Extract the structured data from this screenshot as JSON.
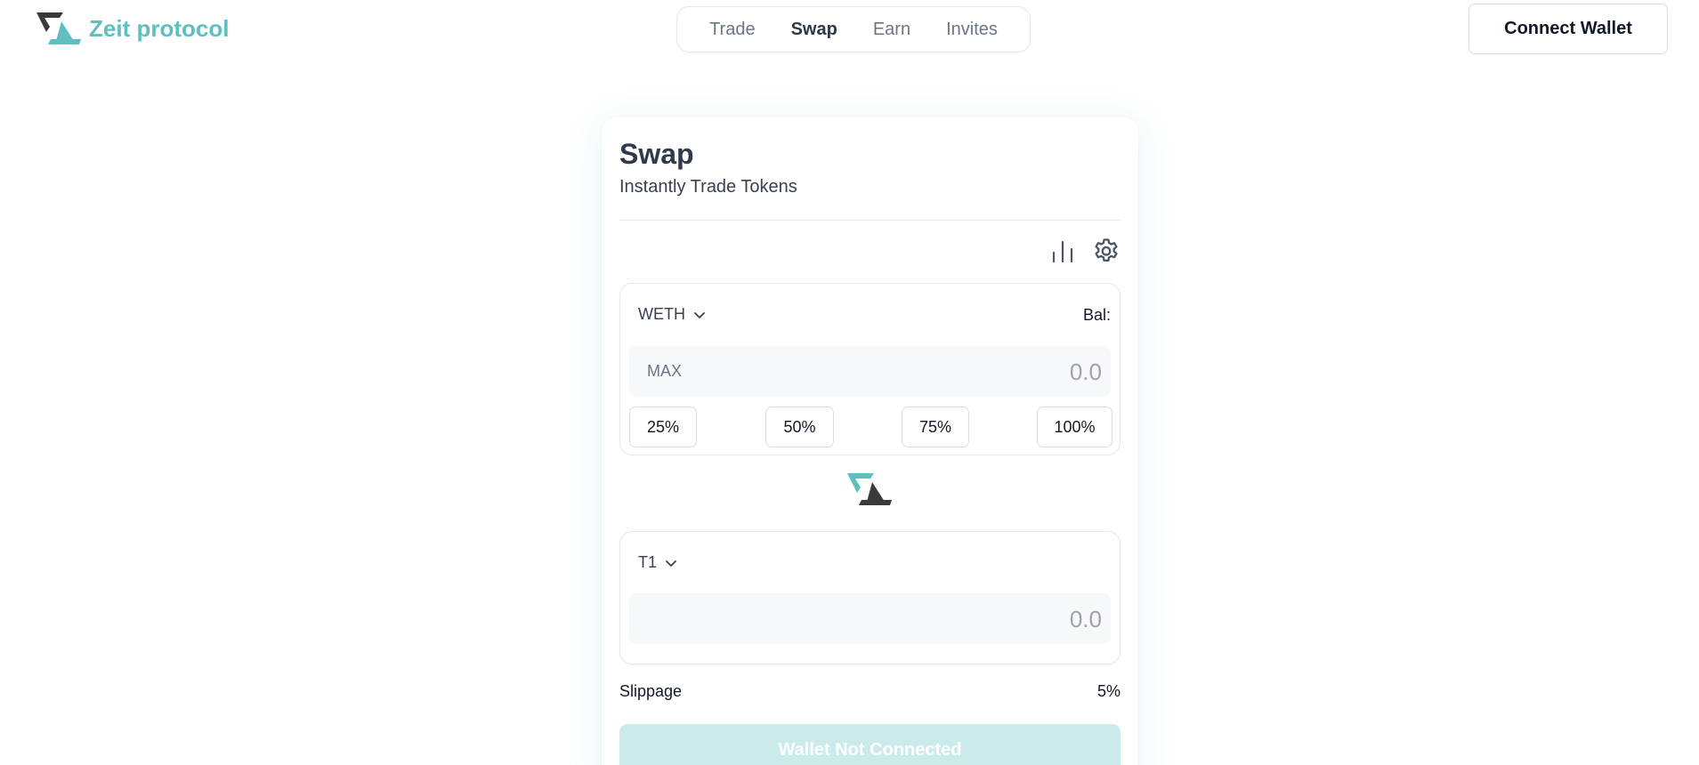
{
  "brand": {
    "name": "Zeit protocol",
    "logo_icon": "zeit-logo"
  },
  "nav": {
    "items": [
      {
        "label": "Trade",
        "active": false
      },
      {
        "label": "Swap",
        "active": true
      },
      {
        "label": "Earn",
        "active": false
      },
      {
        "label": "Invites",
        "active": false
      }
    ]
  },
  "header": {
    "connect_label": "Connect Wallet"
  },
  "swap": {
    "title": "Swap",
    "subtitle": "Instantly Trade Tokens",
    "toolbar": {
      "chart_icon": "bar-chart-icon",
      "settings_icon": "gear-icon"
    },
    "from": {
      "token": "WETH",
      "balance_label": "Bal:",
      "max_label": "MAX",
      "amount_placeholder": "0.0",
      "percent_buttons": [
        "25%",
        "50%",
        "75%",
        "100%"
      ]
    },
    "to": {
      "token": "T1",
      "amount_placeholder": "0.0"
    },
    "slippage": {
      "label": "Slippage",
      "value": "5%"
    },
    "submit_label": "Wallet Not Connected"
  },
  "colors": {
    "brand": "#5fbfbf",
    "logo_dark": "#3a3a3a",
    "button_disabled_bg": "#cbeaea"
  }
}
